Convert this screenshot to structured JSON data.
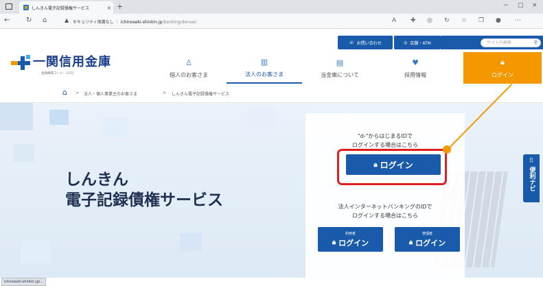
{
  "browser": {
    "tab_title": "しんきん電子記録債権サービス",
    "tab_close": "×",
    "new_tab": "+",
    "security_warning": "セキュリティ保護なし",
    "url_host": "ichinoseki-shinkin.jp",
    "url_path": "/banking/densai/",
    "window_controls": [
      "−",
      "□",
      "×"
    ]
  },
  "header": {
    "contact_label": "お問い合わせ",
    "branch_label": "店舗・ATM",
    "search_placeholder": "サイト内検索",
    "logo_text": "一関信用金庫",
    "logo_sub": "金融機関コード：1153",
    "nav": [
      {
        "label": "個人のお客さま"
      },
      {
        "label": "法人のお客さま"
      },
      {
        "label": "当金庫について"
      },
      {
        "label": "採用情報"
      },
      {
        "label": "ログイン"
      }
    ]
  },
  "breadcrumb": {
    "items": [
      "法人・個人事業主のお客さま",
      "しんきん電子記録債権サービス"
    ],
    "separators": [
      ">",
      ">"
    ]
  },
  "hero": {
    "title_line1": "しんきん",
    "title_line2": "電子記録債権サービス",
    "side_nav_label": "便利ナビ"
  },
  "login_panel": {
    "d_id_text_line1": "\"d-\"からはじまるIDで",
    "d_id_text_line2": "ログインする場合はこちら",
    "login_button": "ログイン",
    "ib_text_line1": "法人インターネットバンキングのIDで",
    "ib_text_line2": "ログインする場合はこちら",
    "user_button_small": "利用者",
    "user_button": "ログイン",
    "admin_button_small": "管理者",
    "admin_button": "ログイン"
  },
  "status_bar": {
    "url": "ichinoseki-shinkin.jp/..."
  },
  "colors": {
    "brand_blue": "#1a5aaa",
    "login_orange": "#f39800",
    "highlight_red": "#e02020"
  }
}
